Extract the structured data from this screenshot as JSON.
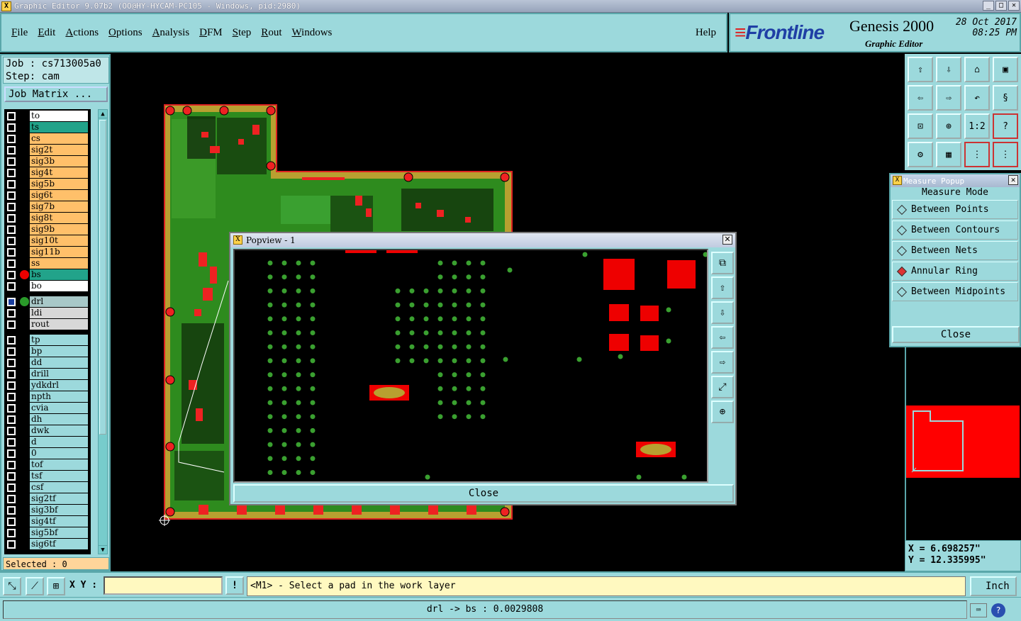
{
  "window": {
    "title": "Graphic Editor 9.07b2 (OO@HY-HYCAM-PC105 - Windows, pid:2980)"
  },
  "menu": {
    "items": [
      "File",
      "Edit",
      "Actions",
      "Options",
      "Analysis",
      "DFM",
      "Step",
      "Rout",
      "Windows"
    ],
    "help": "Help"
  },
  "brand": {
    "logo": "Frontline",
    "product": "Genesis 2000",
    "subtitle": "Graphic Editor",
    "date": "28 Oct 2017",
    "time": "08:25 PM"
  },
  "job": {
    "job_label": "Job : cs713005a0",
    "step_label": "Step: cam",
    "matrix_button": "Job Matrix ..."
  },
  "layers": [
    {
      "name": "to",
      "color": "#ffffff",
      "dot": "",
      "hatch": true
    },
    {
      "name": "ts",
      "color": "#22a38a",
      "dot": ""
    },
    {
      "name": "cs",
      "color": "#ffc06a",
      "dot": ""
    },
    {
      "name": "sig2t",
      "color": "#ffc06a",
      "dot": ""
    },
    {
      "name": "sig3b",
      "color": "#ffc06a",
      "dot": ""
    },
    {
      "name": "sig4t",
      "color": "#ffc06a",
      "dot": ""
    },
    {
      "name": "sig5b",
      "color": "#ffc06a",
      "dot": ""
    },
    {
      "name": "sig6t",
      "color": "#ffc06a",
      "dot": ""
    },
    {
      "name": "sig7b",
      "color": "#ffc06a",
      "dot": ""
    },
    {
      "name": "sig8t",
      "color": "#ffc06a",
      "dot": ""
    },
    {
      "name": "sig9b",
      "color": "#ffc06a",
      "dot": ""
    },
    {
      "name": "sig10t",
      "color": "#ffc06a",
      "dot": ""
    },
    {
      "name": "sig11b",
      "color": "#ffc06a",
      "dot": ""
    },
    {
      "name": "ss",
      "color": "#ffc06a",
      "dot": ""
    },
    {
      "name": "bs",
      "color": "#22a38a",
      "dot": "#e00"
    },
    {
      "name": "bo",
      "color": "#ffffff",
      "dot": ""
    },
    {
      "name": "drl",
      "color": "#a8c8c8",
      "dot": "#2a9a2a",
      "gap": true
    },
    {
      "name": "ldi",
      "color": "#d8d8d8",
      "dot": ""
    },
    {
      "name": "rout",
      "color": "#d8d8d8",
      "dot": ""
    },
    {
      "name": "tp",
      "color": "#9cd9dc",
      "dot": "",
      "gap": true
    },
    {
      "name": "bp",
      "color": "#9cd9dc",
      "dot": ""
    },
    {
      "name": "dd",
      "color": "#9cd9dc",
      "dot": ""
    },
    {
      "name": "drill",
      "color": "#9cd9dc",
      "dot": ""
    },
    {
      "name": "ydkdrl",
      "color": "#9cd9dc",
      "dot": ""
    },
    {
      "name": "npth",
      "color": "#9cd9dc",
      "dot": ""
    },
    {
      "name": "cvia",
      "color": "#9cd9dc",
      "dot": ""
    },
    {
      "name": "dh",
      "color": "#9cd9dc",
      "dot": ""
    },
    {
      "name": "dwk",
      "color": "#9cd9dc",
      "dot": ""
    },
    {
      "name": "d",
      "color": "#9cd9dc",
      "dot": ""
    },
    {
      "name": "0",
      "color": "#9cd9dc",
      "dot": ""
    },
    {
      "name": "tof",
      "color": "#9cd9dc",
      "dot": ""
    },
    {
      "name": "tsf",
      "color": "#9cd9dc",
      "dot": ""
    },
    {
      "name": "csf",
      "color": "#9cd9dc",
      "dot": ""
    },
    {
      "name": "sig2tf",
      "color": "#9cd9dc",
      "dot": ""
    },
    {
      "name": "sig3bf",
      "color": "#9cd9dc",
      "dot": ""
    },
    {
      "name": "sig4tf",
      "color": "#9cd9dc",
      "dot": ""
    },
    {
      "name": "sig5bf",
      "color": "#9cd9dc",
      "dot": ""
    },
    {
      "name": "sig6tf",
      "color": "#9cd9dc",
      "dot": ""
    }
  ],
  "selected_text": "Selected : 0",
  "measure": {
    "title": "Measure Popup",
    "mode_label": "Measure Mode",
    "options": [
      {
        "label": "Between Points",
        "active": false
      },
      {
        "label": "Between Contours",
        "active": false
      },
      {
        "label": "Between Nets",
        "active": false
      },
      {
        "label": "Annular Ring",
        "active": true
      },
      {
        "label": "Between Midpoints",
        "active": false
      }
    ],
    "close": "Close"
  },
  "popview": {
    "title": "Popview - 1",
    "close": "Close"
  },
  "coords": {
    "x": "X =  6.698257\"",
    "y": "Y = 12.335995\""
  },
  "bottom": {
    "xy_label": "X Y :",
    "xy_value": "",
    "bang": "!",
    "prompt": "<M1> - Select a pad in the work layer",
    "unit": "Inch"
  },
  "status": {
    "text": "drl -> bs : 0.0029808"
  },
  "colors": {
    "panel": "#9cd9dc",
    "board_green": "#2e8b1e",
    "board_gold": "#b8a030",
    "pad_red": "#ff0000",
    "drill_green": "#3aa030"
  }
}
